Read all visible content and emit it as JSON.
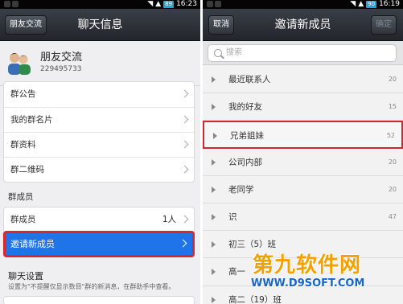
{
  "left": {
    "statusbar": {
      "battery": "89",
      "time": "16:23"
    },
    "toolbar": {
      "back_label": "朋友交流",
      "title": "聊天信息"
    },
    "group": {
      "name": "朋友交流",
      "id": "229495733"
    },
    "info_rows": [
      {
        "label": "群公告"
      },
      {
        "label": "我的群名片"
      },
      {
        "label": "群资料"
      },
      {
        "label": "群二维码"
      }
    ],
    "members_header": "群成员",
    "members_row": {
      "label": "群成员",
      "count": "1人"
    },
    "invite_row": {
      "label": "邀请新成员",
      "selected": true
    },
    "chat_settings": {
      "title": "聊天设置",
      "description": "设置为\"不提醒仅显示数目\"群的新消息，在群助手中查看。"
    }
  },
  "right": {
    "statusbar": {
      "battery": "90",
      "time": "16:19"
    },
    "toolbar": {
      "cancel_label": "取消",
      "title": "邀请新成员",
      "confirm_label": "确定"
    },
    "search": {
      "placeholder": "搜索"
    },
    "groups": [
      {
        "name": "最近联系人",
        "count": "20"
      },
      {
        "name": "我的好友",
        "count": "15"
      },
      {
        "name": "兄弟姐妹",
        "count": "52",
        "highlighted": true
      },
      {
        "name": "公司内部",
        "count": "20"
      },
      {
        "name": "老同学",
        "count": "20"
      },
      {
        "name": "识",
        "count": "47"
      },
      {
        "name": "初三（5）班",
        "count": ""
      },
      {
        "name": "高一",
        "count": ""
      },
      {
        "name": "高二（19）班",
        "count": ""
      }
    ]
  },
  "watermark": {
    "brand": "第九软件网",
    "url": "WWW.D9SOFT.COM"
  },
  "colors": {
    "accent": "#1f74e8",
    "highlight_border": "#d9282c",
    "toolbar": "#2b3036",
    "watermark_orange": "#f4a100",
    "watermark_blue": "#1766c8"
  }
}
